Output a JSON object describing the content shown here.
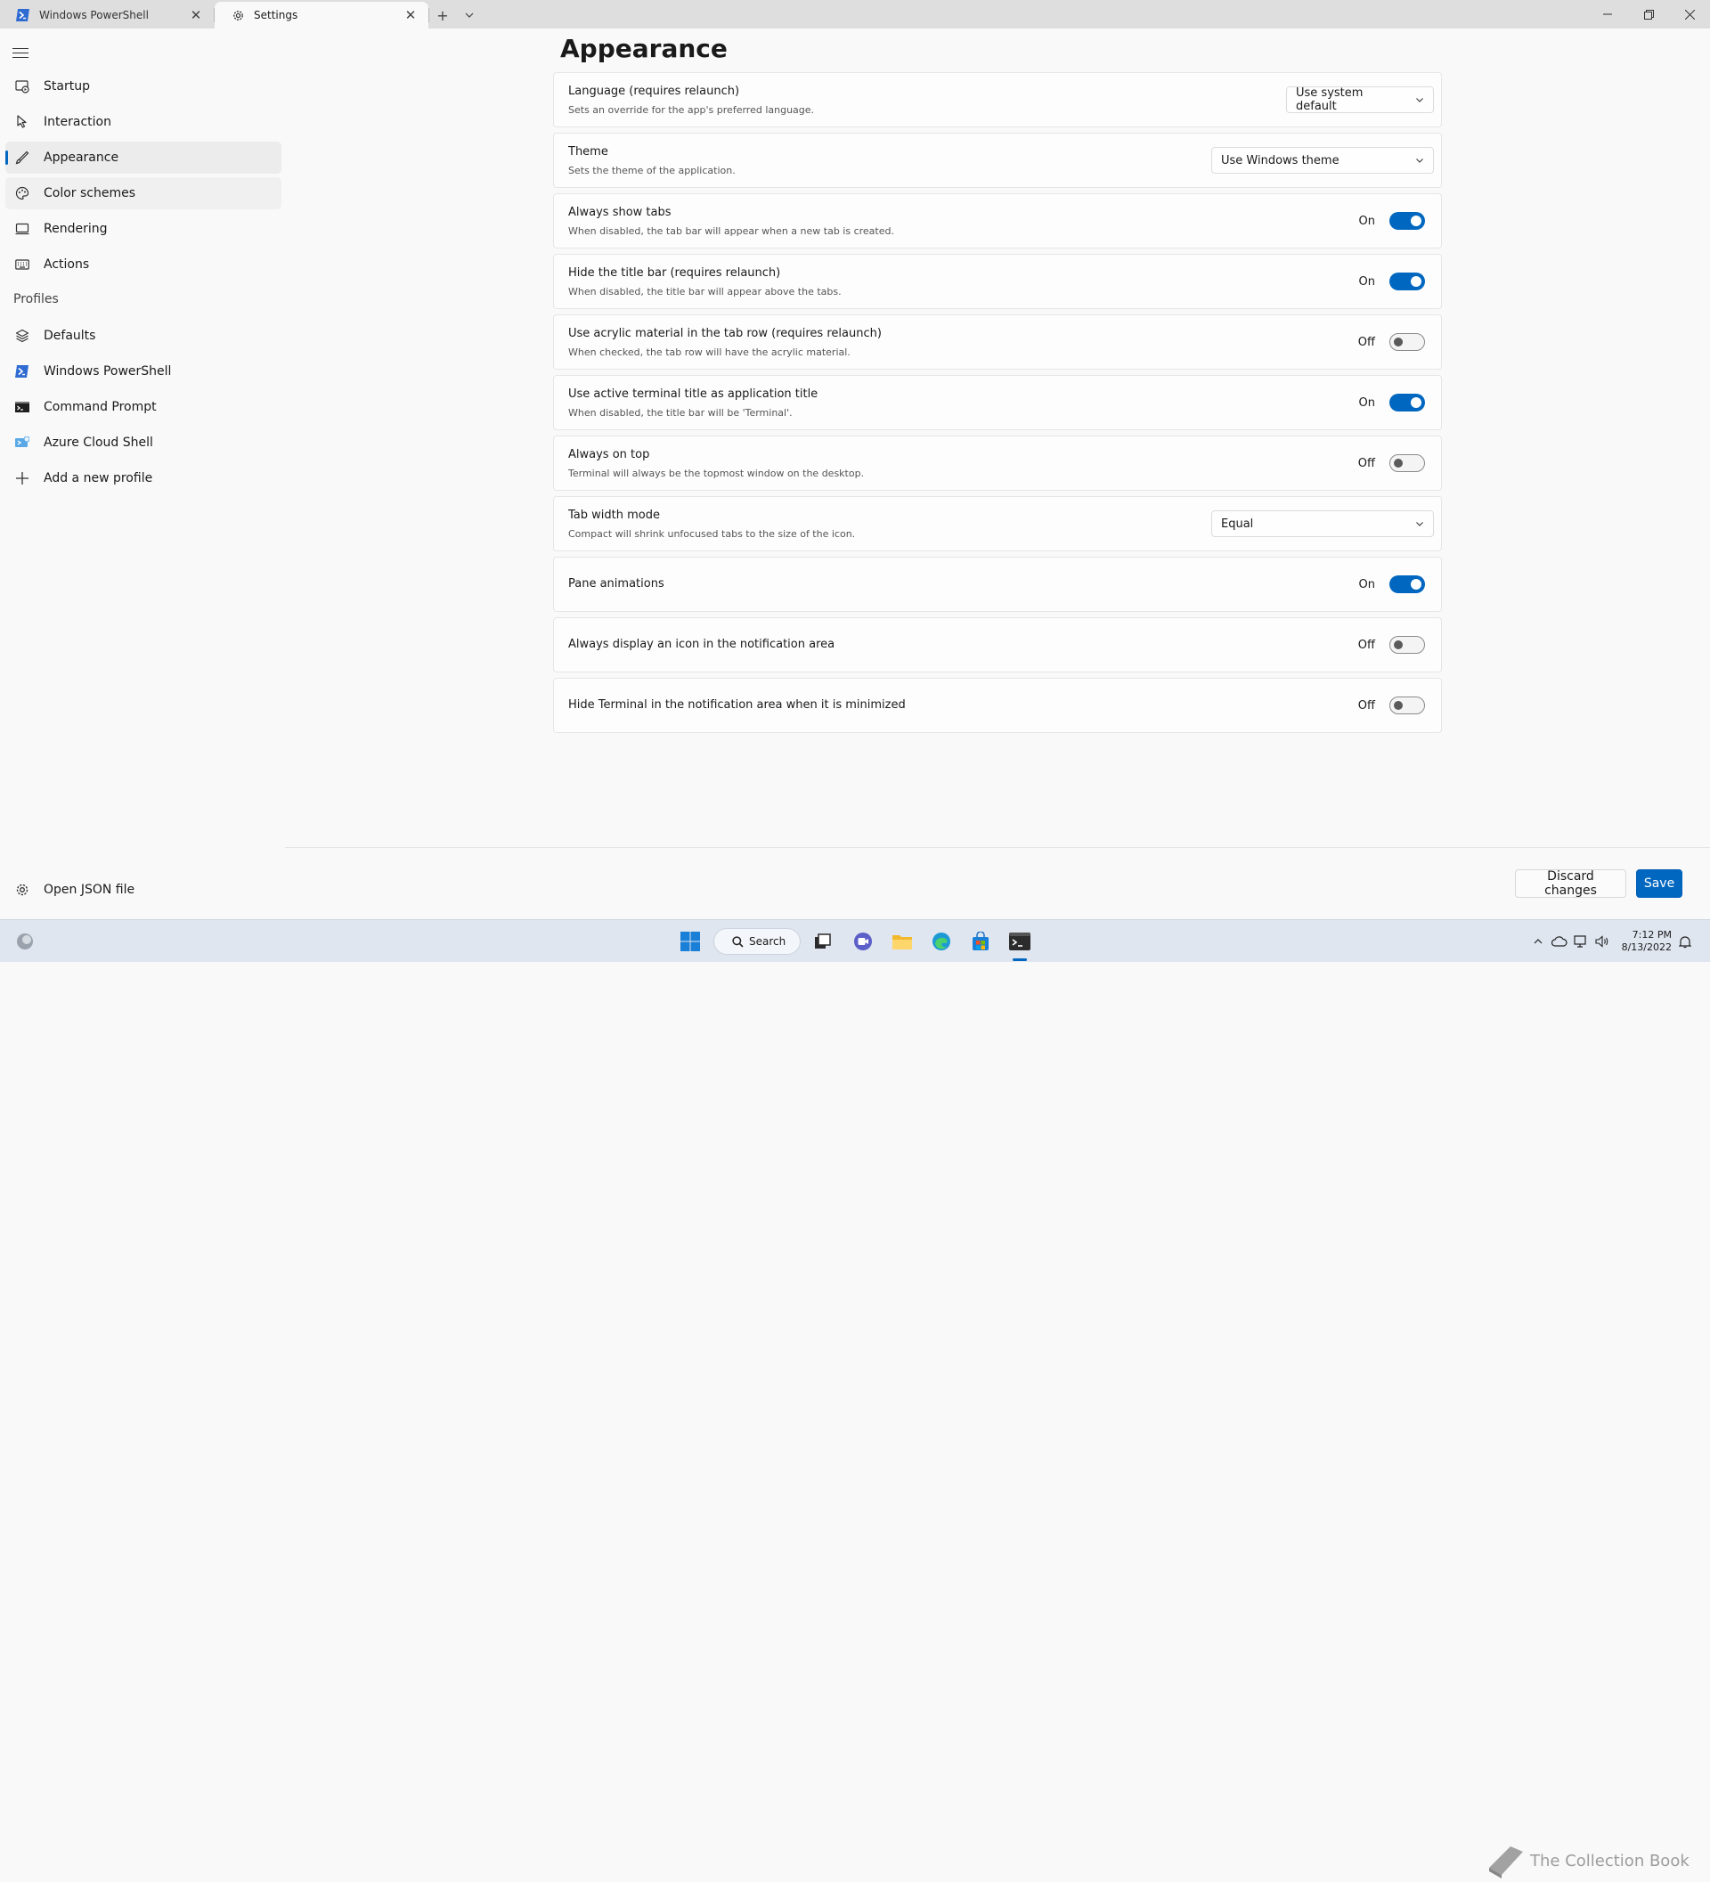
{
  "tabs": [
    {
      "label": "Windows PowerShell",
      "icon": "powershell-icon",
      "active": false
    },
    {
      "label": "Settings",
      "icon": "gear-icon",
      "active": true
    }
  ],
  "sidebar": {
    "items": [
      {
        "label": "Startup",
        "icon": "startup-icon"
      },
      {
        "label": "Interaction",
        "icon": "cursor-icon"
      },
      {
        "label": "Appearance",
        "icon": "brush-icon",
        "selected": true
      },
      {
        "label": "Color schemes",
        "icon": "palette-icon"
      },
      {
        "label": "Rendering",
        "icon": "monitor-icon"
      },
      {
        "label": "Actions",
        "icon": "keyboard-icon"
      }
    ],
    "profiles_header": "Profiles",
    "profiles": [
      {
        "label": "Defaults",
        "icon": "layers-icon"
      },
      {
        "label": "Windows PowerShell",
        "icon": "powershell-icon"
      },
      {
        "label": "Command Prompt",
        "icon": "cmd-icon"
      },
      {
        "label": "Azure Cloud Shell",
        "icon": "azure-icon"
      },
      {
        "label": "Add a new profile",
        "icon": "plus-icon"
      }
    ],
    "open_json": "Open JSON file"
  },
  "main": {
    "title": "Appearance",
    "settings": [
      {
        "title": "Language (requires relaunch)",
        "desc": "Sets an override for the app's preferred language.",
        "control": "dropdown",
        "value": "Use system default"
      },
      {
        "title": "Theme",
        "desc": "Sets the theme of the application.",
        "control": "dropdown",
        "value": "Use Windows theme"
      },
      {
        "title": "Always show tabs",
        "desc": "When disabled, the tab bar will appear when a new tab is created.",
        "control": "toggle",
        "on": true,
        "state": "On"
      },
      {
        "title": "Hide the title bar (requires relaunch)",
        "desc": "When disabled, the title bar will appear above the tabs.",
        "control": "toggle",
        "on": true,
        "state": "On"
      },
      {
        "title": "Use acrylic material in the tab row (requires relaunch)",
        "desc": "When checked, the tab row will have the acrylic material.",
        "control": "toggle",
        "on": false,
        "state": "Off"
      },
      {
        "title": "Use active terminal title as application title",
        "desc": "When disabled, the title bar will be 'Terminal'.",
        "control": "toggle",
        "on": true,
        "state": "On"
      },
      {
        "title": "Always on top",
        "desc": "Terminal will always be the topmost window on the desktop.",
        "control": "toggle",
        "on": false,
        "state": "Off"
      },
      {
        "title": "Tab width mode",
        "desc": "Compact will shrink unfocused tabs to the size of the icon.",
        "control": "dropdown",
        "value": "Equal"
      },
      {
        "title": "Pane animations",
        "desc": "",
        "control": "toggle",
        "on": true,
        "state": "On"
      },
      {
        "title": "Always display an icon in the notification area",
        "desc": "",
        "control": "toggle",
        "on": false,
        "state": "Off"
      },
      {
        "title": "Hide Terminal in the notification area when it is minimized",
        "desc": "",
        "control": "toggle",
        "on": false,
        "state": "Off"
      }
    ]
  },
  "footer": {
    "discard_label": "Discard changes",
    "save_label": "Save"
  },
  "taskbar": {
    "search_label": "Search",
    "time": "7:12 PM",
    "date": "8/13/2022",
    "watermark": "The Collection Book"
  },
  "colors": {
    "accent": "#0067c0",
    "background": "#f9f9f9",
    "tabbar": "#dedede",
    "taskbar": "#dfe6f0"
  }
}
